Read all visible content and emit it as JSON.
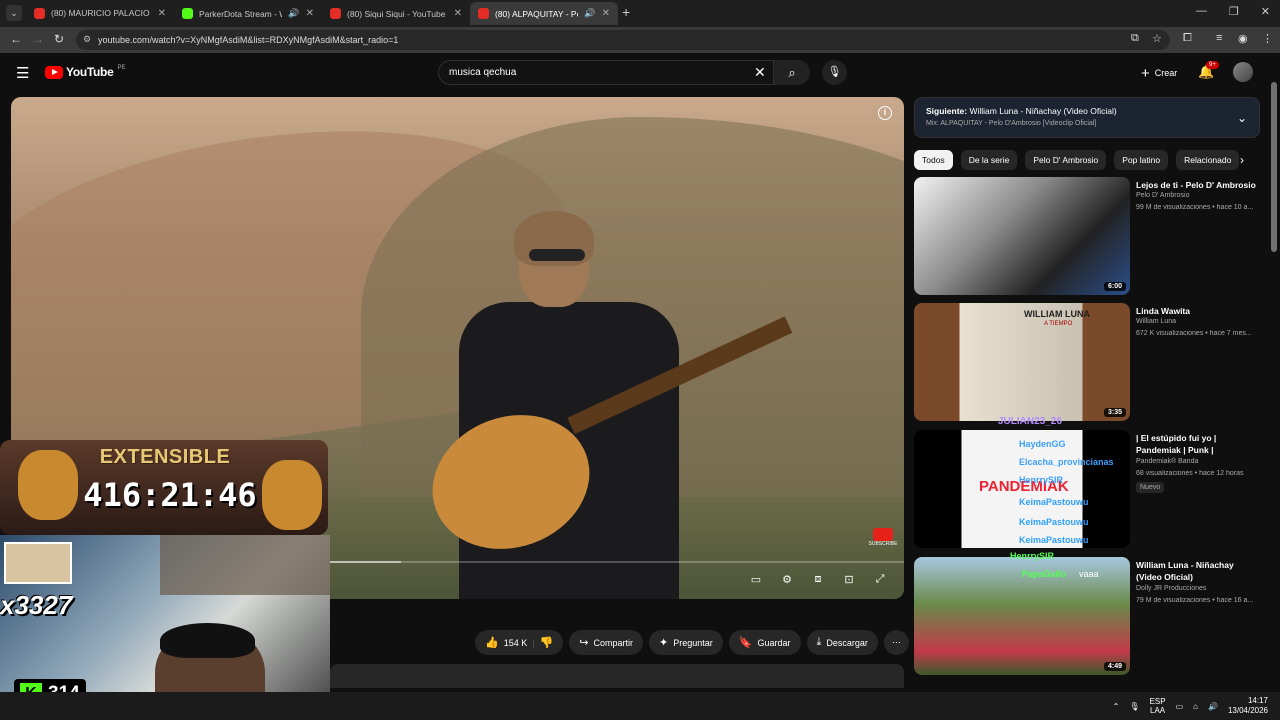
{
  "browser": {
    "tabs": [
      {
        "title": "(80) MAURICIO PALACIO 🏔️ Yá",
        "favicon": "youtube",
        "active": false
      },
      {
        "title": "ParkerDota Stream - Watch",
        "favicon": "kick",
        "active": false
      },
      {
        "title": "(80) Siqui Siqui - YouTube",
        "favicon": "youtube",
        "active": false
      },
      {
        "title": "(80) ALPAQUITAY - Pelo D'A",
        "favicon": "youtube",
        "active": true
      }
    ],
    "url": "youtube.com/watch?v=XyNMgfAsdiM&list=RDXyNMgfAsdiM&start_radio=1"
  },
  "youtube": {
    "logo_text": "YouTube",
    "country_code": "PE",
    "search_value": "musica qechua",
    "create_label": "Crear",
    "notifications_badge": "9+"
  },
  "stream_overlay": {
    "banner_title": "EXTENSIBLE",
    "timer": "416:21:46",
    "big_text": "x3327",
    "kick_viewers": "314",
    "chat_names": [
      "HaydenGG",
      "Elcacha_provincianas",
      "HenrrySIR",
      "KeimaPastouwu",
      "KeimaPastouwu",
      "KeimaPastouwu",
      "HenrrySIR",
      "PapaGallo",
      "JULIAN23_26"
    ],
    "chat_last_message": "vaaa"
  },
  "actions": {
    "like_count": "154 K",
    "share_label": "Compartir",
    "ask_label": "Preguntar",
    "save_label": "Guardar",
    "download_label": "Descargar"
  },
  "up_next": {
    "next_prefix": "Siguiente:",
    "next_title": "William Luna - Niñachay (Video Oficial)",
    "mix_label": "Mix: ALPAQUITAY - Pelo D'Ambrosio [Videoclip Oficial]"
  },
  "chips": [
    "Todos",
    "De la serie",
    "Pelo D' Ambrosio",
    "Pop latino",
    "Relacionado"
  ],
  "recommendations": [
    {
      "title": "Lejos de ti - Pelo D' Ambrosio",
      "channel": "Pelo D' Ambrosio",
      "meta": "99 M de visualizaciones • hace 10 a...",
      "duration": "6:00",
      "badge": ""
    },
    {
      "title": "Linda Wawita",
      "channel": "William Luna",
      "meta": "672 K visualizaciones • hace 7 mes...",
      "duration": "3:35",
      "badge": "",
      "thumb_text": "WILLIAM LUNA",
      "thumb_sub": "A TIEMPO"
    },
    {
      "title": "| El estúpido fui yo | Pandemiak | Punk |",
      "channel": "Pandemiak® Banda",
      "meta": "68 visualizaciones • hace 12 horas",
      "duration": "",
      "badge": "Nuevo",
      "thumb_text": "PANDEMIAK"
    },
    {
      "title": "William Luna - Niñachay (Video Oficial)",
      "channel": "Dolly JR Producciones",
      "meta": "79 M de visualizaciones • hace 16 a...",
      "duration": "4:49",
      "badge": ""
    }
  ],
  "taskbar": {
    "lang": "ESP",
    "layout": "LAA",
    "time": "14:17",
    "date": "13/04/2026"
  }
}
